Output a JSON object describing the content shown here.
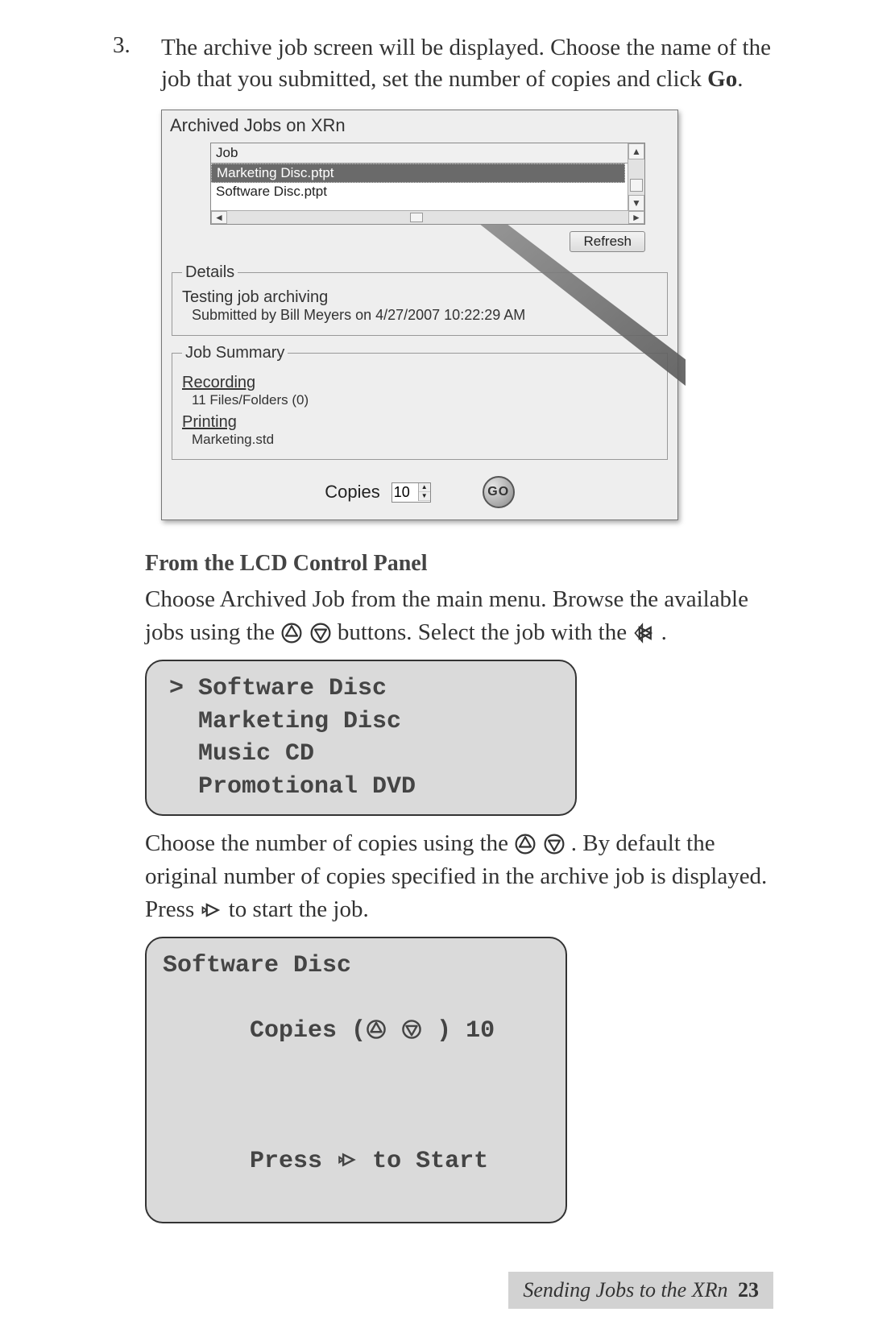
{
  "step": {
    "number": "3.",
    "text_before_bold": "The archive job screen will be displayed.  Choose the name of the job that you submitted, set the number of copies and click ",
    "bold": "Go",
    "text_after_bold": "."
  },
  "screenshot": {
    "title": "Archived Jobs on XRn",
    "job_header": "Job",
    "jobs": [
      "Marketing Disc.ptpt",
      "Software Disc.ptpt"
    ],
    "refresh_label": "Refresh",
    "details": {
      "legend": "Details",
      "line1": "Testing job archiving",
      "line2": "Submitted by Bill Meyers on 4/27/2007 10:22:29 AM"
    },
    "summary": {
      "legend": "Job Summary",
      "recording_heading": "Recording",
      "recording_line": "11 Files/Folders (0)",
      "printing_heading": "Printing",
      "printing_line": "Marketing.std"
    },
    "copies_label": "Copies",
    "copies_value": "10",
    "go_label": "GO"
  },
  "subheading": "From the LCD Control Panel",
  "para1_a": "Choose Archived Job from the main menu. Browse the available jobs using the ",
  "para1_b": " buttons.  Select the job with the ",
  "para1_c": " .",
  "lcd1": {
    "lines": [
      "> Software Disc",
      "  Marketing Disc",
      "  Music CD",
      "  Promotional DVD"
    ]
  },
  "para2_a": "Choose the number of copies using the ",
  "para2_b": ".  By default the original number of copies specified in the archive job is displayed.  Press ",
  "para2_c": " to start the job.",
  "lcd2": {
    "line1": "Software Disc",
    "line2_a": "Copies (",
    "line2_b": " ) 10",
    "line3": " ",
    "line4_a": "Press ",
    "line4_b": " to Start"
  },
  "footer": {
    "section": "Sending Jobs to the XRn",
    "page": "23"
  }
}
